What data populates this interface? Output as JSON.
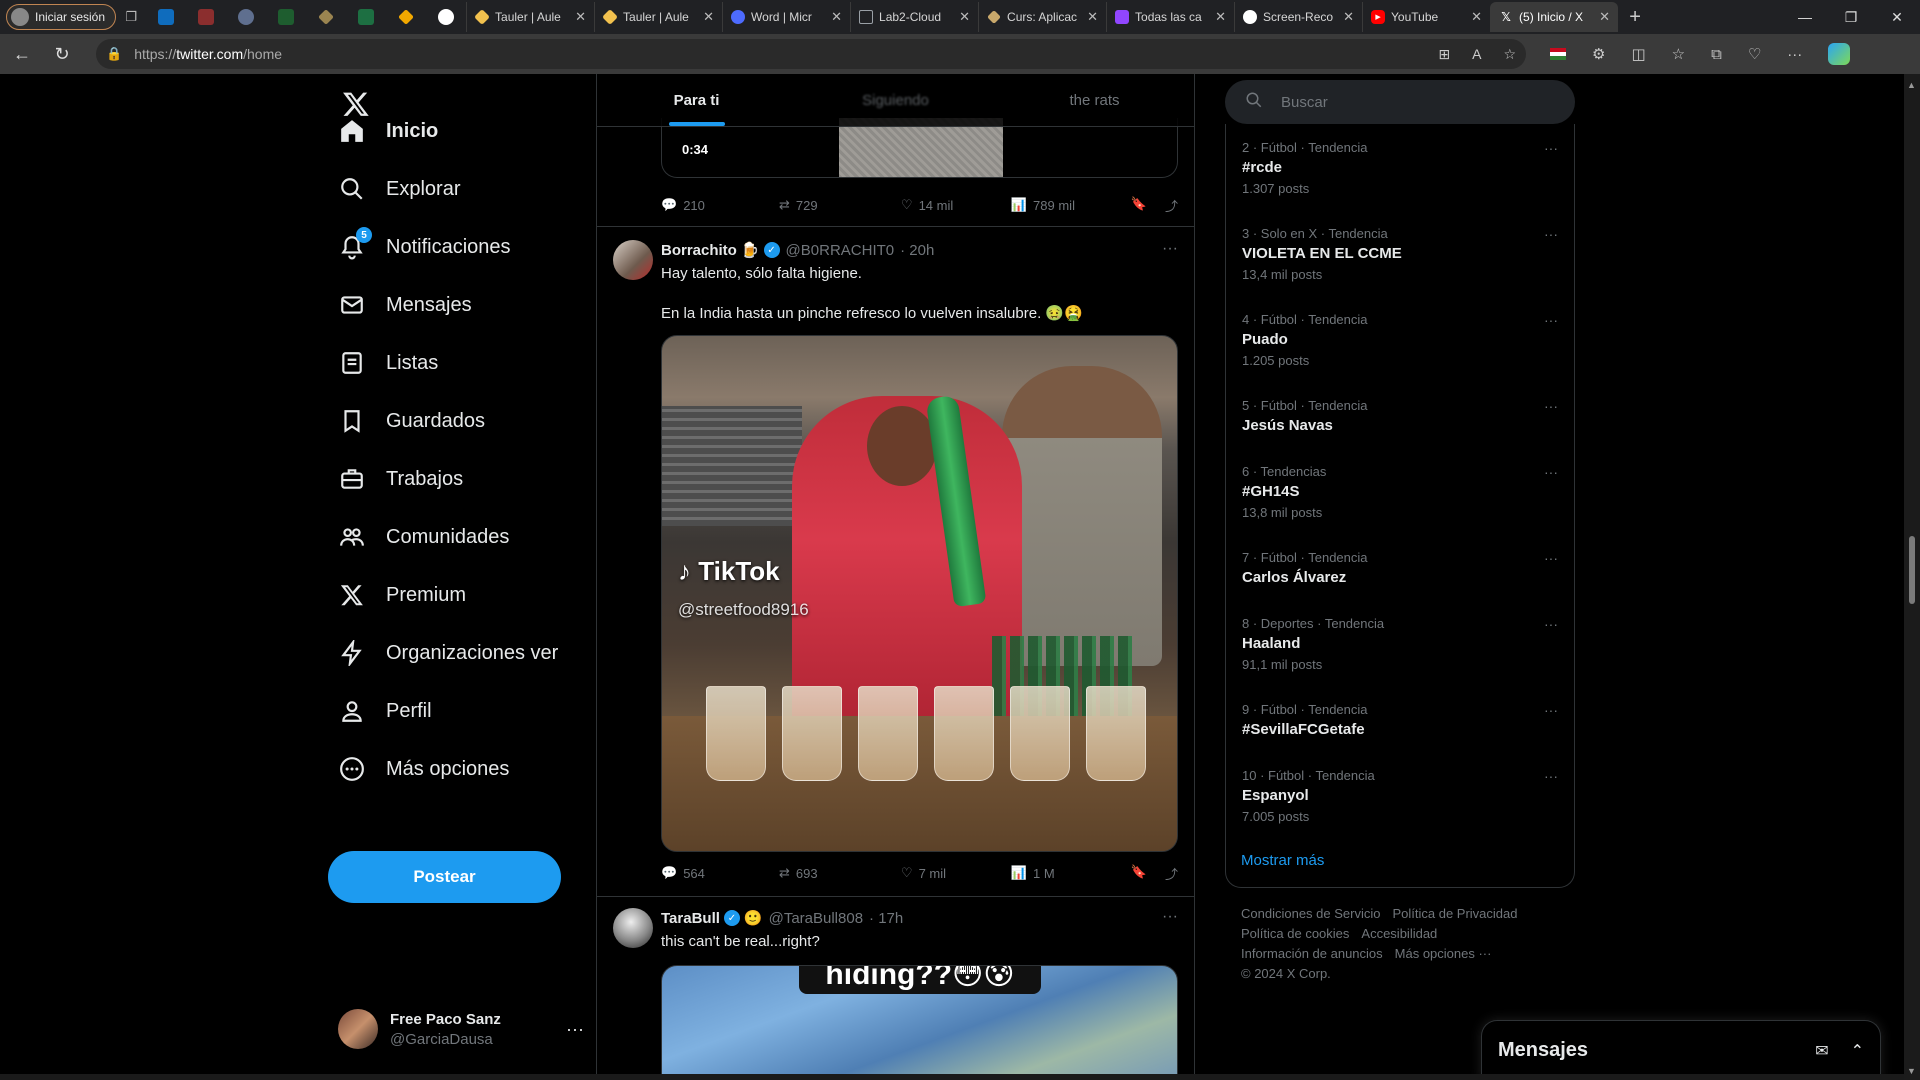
{
  "browser": {
    "profile_label": "Iniciar sesión",
    "tabs": [
      {
        "title": "Tauler | Aule",
        "fav_color": "#f2c14e"
      },
      {
        "title": "Tauler | Aule",
        "fav_color": "#f2c14e"
      },
      {
        "title": "Word | Micr",
        "fav_color": "#4d6bfe"
      },
      {
        "title": "Lab2-Cloud",
        "fav_color": "#9aa0a6"
      },
      {
        "title": "Curs: Aplicac",
        "fav_color": "#c8a86b"
      },
      {
        "title": "Todas las ca",
        "fav_color": "#9146ff"
      },
      {
        "title": "Screen-Reco",
        "fav_color": "#ffffff"
      },
      {
        "title": "YouTube",
        "fav_color": "#ff0000"
      },
      {
        "title": "(5) Inicio / X",
        "fav_color": "#ffffff"
      }
    ],
    "url_prefix": "https://",
    "url_host": "twitter.com",
    "url_path": "/home"
  },
  "nav": {
    "items": [
      {
        "label": "Inicio",
        "icon": "home-icon"
      },
      {
        "label": "Explorar",
        "icon": "search-icon"
      },
      {
        "label": "Notificaciones",
        "icon": "bell-icon",
        "badge": "5"
      },
      {
        "label": "Mensajes",
        "icon": "mail-icon"
      },
      {
        "label": "Listas",
        "icon": "list-icon"
      },
      {
        "label": "Guardados",
        "icon": "bookmark-icon"
      },
      {
        "label": "Trabajos",
        "icon": "briefcase-icon"
      },
      {
        "label": "Comunidades",
        "icon": "people-icon"
      },
      {
        "label": "Premium",
        "icon": "x-icon"
      },
      {
        "label": "Organizaciones ver",
        "icon": "lightning-icon"
      },
      {
        "label": "Perfil",
        "icon": "person-icon"
      },
      {
        "label": "Más opciones",
        "icon": "more-circle-icon"
      }
    ],
    "post_label": "Postear",
    "account": {
      "name": "Free Paco Sanz",
      "handle": "@GarciaDausa"
    }
  },
  "feed": {
    "tabs": [
      "Para ti",
      "Siguiendo",
      "the rats"
    ],
    "prev_tweet": {
      "duration": "0:34",
      "replies": "210",
      "reposts": "729",
      "likes": "14 mil",
      "views": "789 mil"
    },
    "tweet1": {
      "name": "Borrachito",
      "handle": "@B0RRACHIT0",
      "time": "· 20h",
      "line1": "Hay talento, sólo falta higiene.",
      "line2": "En la India hasta un pinche refresco lo vuelven insalubre. 🤢🤮",
      "media_watermark": "TikTok",
      "media_handle": "@streetfood8916",
      "replies": "564",
      "reposts": "693",
      "likes": "7 mil",
      "views": "1 M"
    },
    "tweet2": {
      "name": "TaraBull",
      "handle": "@TaraBull808",
      "time": "· 17h",
      "text": "this can't be real...right?",
      "media_caption": "hiding??😳😰"
    }
  },
  "search": {
    "placeholder": "Buscar"
  },
  "trends": [
    {
      "cat": "2 · Fútbol · Tendencia",
      "name": "#rcde",
      "count": "1.307 posts"
    },
    {
      "cat": "3 · Solo en X · Tendencia",
      "name": "VIOLETA EN EL CCME",
      "count": "13,4 mil posts"
    },
    {
      "cat": "4 · Fútbol · Tendencia",
      "name": "Puado",
      "count": "1.205 posts"
    },
    {
      "cat": "5 · Fútbol · Tendencia",
      "name": "Jesús Navas",
      "count": ""
    },
    {
      "cat": "6 · Tendencias",
      "name": "#GH14S",
      "count": "13,8 mil posts"
    },
    {
      "cat": "7 · Fútbol · Tendencia",
      "name": "Carlos Álvarez",
      "count": ""
    },
    {
      "cat": "8 · Deportes · Tendencia",
      "name": "Haaland",
      "count": "91,1 mil posts"
    },
    {
      "cat": "9 · Fútbol · Tendencia",
      "name": "#SevillaFCGetafe",
      "count": ""
    },
    {
      "cat": "10 · Fútbol · Tendencia",
      "name": "Espanyol",
      "count": "7.005 posts"
    }
  ],
  "show_more": "Mostrar más",
  "footer": {
    "links": [
      "Condiciones de Servicio",
      "Política de Privacidad",
      "Política de cookies",
      "Accesibilidad",
      "Información de anuncios",
      "Más opciones ···"
    ],
    "copyright": "© 2024 X Corp."
  },
  "messages_dock": {
    "title": "Mensajes"
  },
  "colors": {
    "accent": "#1d9bf0",
    "background": "#000000",
    "border": "#2f3336",
    "muted": "#71767b"
  }
}
